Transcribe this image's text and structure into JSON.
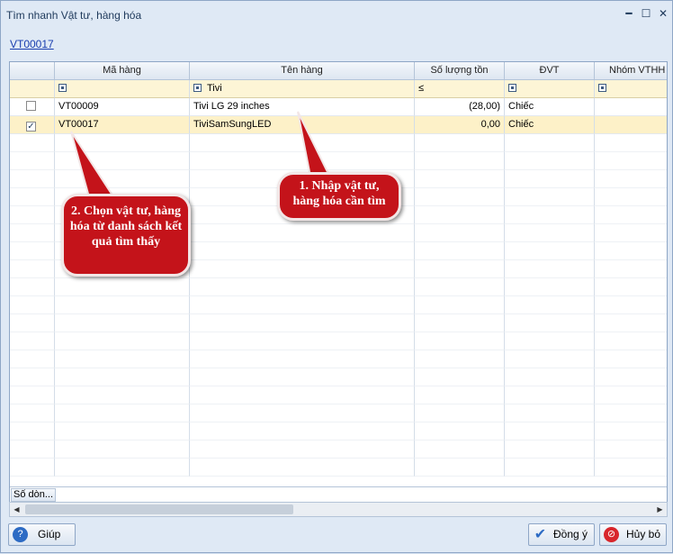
{
  "window": {
    "title": "Tìm nhanh Vật tư, hàng hóa",
    "minimize": "━",
    "maximize": "☐",
    "close": "✕"
  },
  "selected_link": "VT00017",
  "grid": {
    "columns": [
      "",
      "Mã hàng",
      "Tên hàng",
      "Số lượng tồn",
      "ĐVT",
      "Nhóm VTHH"
    ],
    "filter": {
      "ten_hang": "Tivi",
      "so_luong_op": "≤"
    },
    "rows": [
      {
        "checked": false,
        "ma_hang": "VT00009",
        "ten_hang": "Tivi LG 29 inches",
        "so_luong": "(28,00)",
        "dvt": "Chiếc"
      },
      {
        "checked": true,
        "ma_hang": "VT00017",
        "ten_hang": "TiviSamSungLED",
        "so_luong": "0,00",
        "dvt": "Chiếc"
      }
    ],
    "footer_label": "Số dòn..."
  },
  "callouts": {
    "first": "1. Nhập vật tư, hàng hóa cần tìm",
    "second": "2. Chọn vật tư, hàng hóa từ danh sách kết quả tìm thấy"
  },
  "buttons": {
    "help": "Giúp",
    "ok": "Đồng ý",
    "cancel": "Hủy bỏ"
  },
  "colors": {
    "callout": "#c4131a",
    "selected_row": "#fdf1c8",
    "filter_row": "#fdf5d6",
    "link": "#1a3fb0"
  }
}
